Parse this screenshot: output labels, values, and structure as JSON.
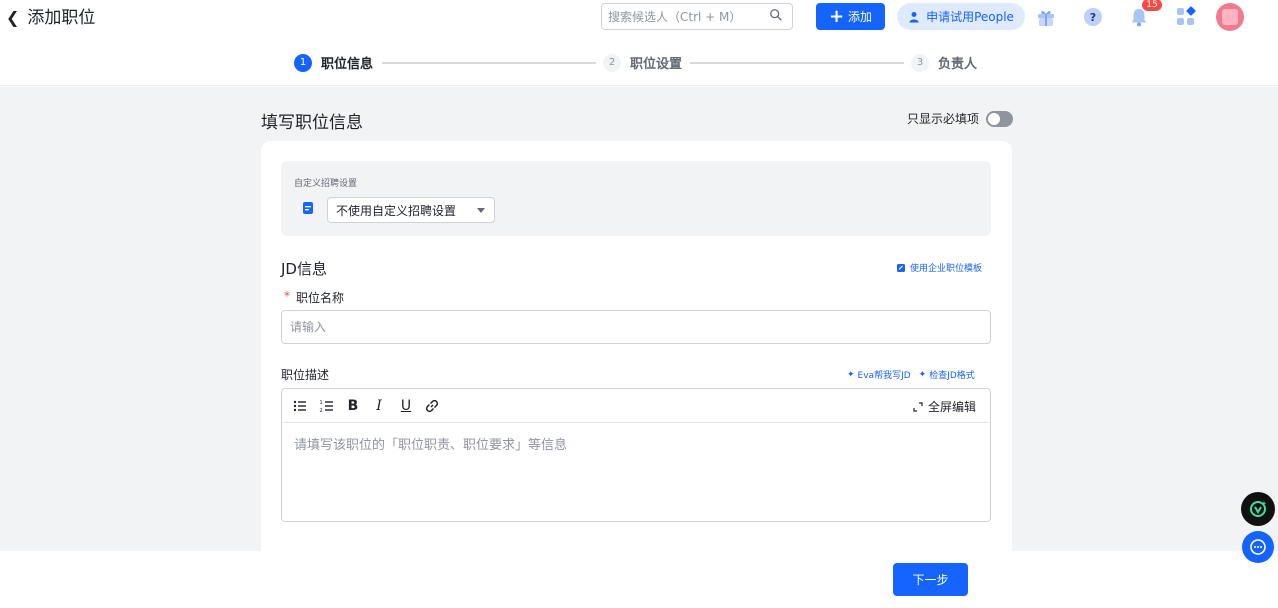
{
  "header": {
    "back_title": "添加职位",
    "search_placeholder": "搜索候选人（Ctrl + M）",
    "add_label": "添加",
    "trial_label": "申请试用People",
    "notification_count": "15"
  },
  "stepper": {
    "steps": [
      {
        "num": "1",
        "label": "职位信息"
      },
      {
        "num": "2",
        "label": "职位设置"
      },
      {
        "num": "3",
        "label": "负责人"
      }
    ]
  },
  "form": {
    "section_title": "填写职位信息",
    "toggle_label": "只显示必填项",
    "custom_label": "自定义招聘设置",
    "custom_select_value": "不使用自定义招聘设置",
    "jd_title": "JD信息",
    "template_link": "使用企业职位模板",
    "required_star": "*",
    "position_name_label": "职位名称",
    "position_name_placeholder": "请输入",
    "desc_label": "职位描述",
    "eva_link": "Eva帮我写JD",
    "check_link": "检查JD格式",
    "fullscreen_label": "全屏编辑",
    "editor_placeholder": "请填写该职位的「职位职责、职位要求」等信息",
    "toolbar": {
      "bold": "B",
      "italic": "I",
      "underline": "U"
    },
    "next_label": "下一步"
  },
  "colors": {
    "primary": "#1664ff",
    "background": "#f2f3f5",
    "badge": "#f54a45"
  }
}
